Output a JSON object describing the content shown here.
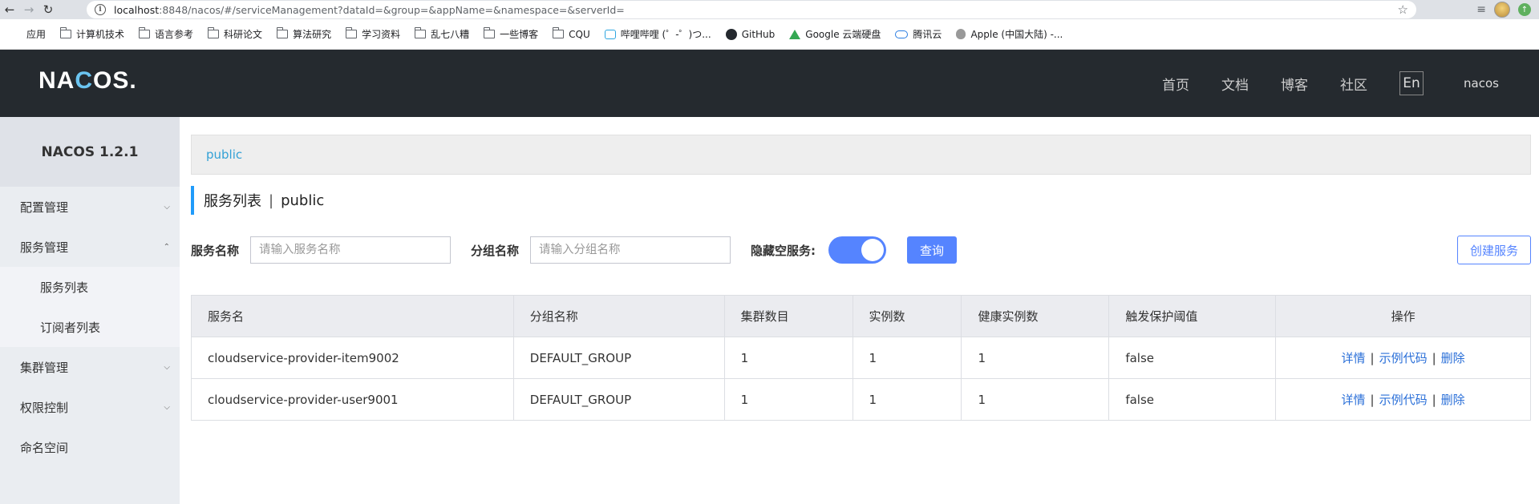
{
  "browser": {
    "url_host": "localhost",
    "url_rest": ":8848/nacos/#/serviceManagement?dataId=&group=&appName=&namespace=&serverId=",
    "bookmarks": [
      {
        "label": "应用",
        "icon": "apps-icon"
      },
      {
        "label": "计算机技术",
        "icon": "folder-icon"
      },
      {
        "label": "语言参考",
        "icon": "folder-icon"
      },
      {
        "label": "科研论文",
        "icon": "folder-icon"
      },
      {
        "label": "算法研究",
        "icon": "folder-icon"
      },
      {
        "label": "学习资料",
        "icon": "folder-icon"
      },
      {
        "label": "乱七八糟",
        "icon": "folder-icon"
      },
      {
        "label": "一些博客",
        "icon": "folder-icon"
      },
      {
        "label": "CQU",
        "icon": "folder-icon"
      },
      {
        "label": "哔哩哔哩 (゜-゜)つ...",
        "icon": "bilibili-icon"
      },
      {
        "label": "GitHub",
        "icon": "github-icon"
      },
      {
        "label": "Google 云端硬盘",
        "icon": "google-drive-icon"
      },
      {
        "label": "腾讯云",
        "icon": "tencent-cloud-icon"
      },
      {
        "label": "Apple (中国大陆) -...",
        "icon": "apple-icon"
      }
    ]
  },
  "header": {
    "logo_prefix": "NA",
    "logo_c": "C",
    "logo_suffix": "OS.",
    "nav": [
      "首页",
      "文档",
      "博客",
      "社区"
    ],
    "lang": "En",
    "user": "nacos"
  },
  "sidebar": {
    "version": "NACOS 1.2.1",
    "items": [
      {
        "label": "配置管理",
        "chevron": "down"
      },
      {
        "label": "服务管理",
        "chevron": "up"
      },
      {
        "label": "服务列表"
      },
      {
        "label": "订阅者列表"
      },
      {
        "label": "集群管理",
        "chevron": "down"
      },
      {
        "label": "权限控制",
        "chevron": "down"
      },
      {
        "label": "命名空间"
      }
    ]
  },
  "main": {
    "namespace": "public",
    "title": "服务列表",
    "title_sep": "|",
    "title_ns": "public",
    "filters": {
      "service_name_label": "服务名称",
      "service_name_placeholder": "请输入服务名称",
      "group_name_label": "分组名称",
      "group_name_placeholder": "请输入分组名称",
      "hide_empty_label": "隐藏空服务:",
      "hide_empty_on": true,
      "query_label": "查询",
      "create_label": "创建服务"
    },
    "table": {
      "headers": [
        "服务名",
        "分组名称",
        "集群数目",
        "实例数",
        "健康实例数",
        "触发保护阈值",
        "操作"
      ],
      "rows": [
        [
          "cloudservice-provider-item9002",
          "DEFAULT_GROUP",
          "1",
          "1",
          "1",
          "false"
        ],
        [
          "cloudservice-provider-user9001",
          "DEFAULT_GROUP",
          "1",
          "1",
          "1",
          "false"
        ]
      ],
      "ops": [
        "详情",
        "示例代码",
        "删除"
      ],
      "op_sep": "|"
    }
  },
  "colors": {
    "header_bg": "#252a2f",
    "primary": "#5584ff",
    "link": "#2a6fd8",
    "namespace_link": "#33a1d6",
    "title_bar": "#209bfa"
  }
}
